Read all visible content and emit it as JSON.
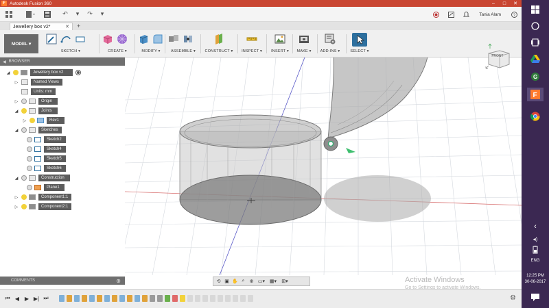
{
  "window": {
    "title": "Autodesk Fusion 360",
    "app_icon_letter": "F"
  },
  "quick_access": {
    "user_name": "Tania Alam"
  },
  "document_tab": {
    "label": "Jewellery box v2*"
  },
  "ribbon": {
    "workspace_label": "MODEL ▾",
    "groups": {
      "sketch": "SKETCH ▾",
      "create": "CREATE ▾",
      "modify": "MODIFY ▾",
      "assemble": "ASSEMBLE ▾",
      "construct": "CONSTRUCT ▾",
      "inspect": "INSPECT ▾",
      "insert": "INSERT ▾",
      "make": "MAKE ▾",
      "addins": "ADD-INS ▾",
      "select": "SELECT ▾"
    }
  },
  "browser": {
    "header": "BROWSER",
    "items": [
      {
        "label": "Jewellery box v2",
        "icon": "component-icon"
      },
      {
        "label": "Named Views",
        "icon": "folder-icon"
      },
      {
        "label": "Units: mm",
        "icon": "document-icon"
      },
      {
        "label": "Origin",
        "icon": "folder-icon"
      },
      {
        "label": "Joints",
        "icon": "folder-icon"
      },
      {
        "label": "Rev1",
        "icon": "joint-icon"
      },
      {
        "label": "Sketches",
        "icon": "folder-icon"
      },
      {
        "label": "Sketch2",
        "icon": "sketch-icon"
      },
      {
        "label": "Sketch4",
        "icon": "sketch-icon"
      },
      {
        "label": "Sketch5",
        "icon": "sketch-icon"
      },
      {
        "label": "Sketch6",
        "icon": "sketch-icon"
      },
      {
        "label": "Construction",
        "icon": "folder-icon"
      },
      {
        "label": "Plane1",
        "icon": "plane-icon"
      },
      {
        "label": "Component1:1",
        "icon": "component-icon"
      },
      {
        "label": "Component2:1",
        "icon": "component-icon"
      }
    ]
  },
  "comments": {
    "label": "COMMENTS"
  },
  "viewcube": {
    "face_label": "FRONT"
  },
  "watermark": {
    "line1": "Activate Windows",
    "line2": "Go to Settings to activate Windows."
  },
  "taskbar": {
    "language": "ENG",
    "time": "12:25 PM",
    "date": "30-06-2017"
  },
  "colors": {
    "title_bar": "#c94632",
    "taskbar": "#3b2852",
    "browser_header": "#6f6f6f",
    "select_accent": "#2d6f9e"
  }
}
